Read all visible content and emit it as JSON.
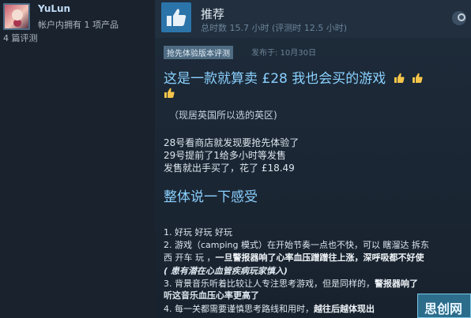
{
  "user": {
    "name": "YuLun",
    "owned": "帐户内拥有 1 项产品",
    "reviews": "4 篇评测"
  },
  "review": {
    "verdict": "推荐",
    "hours": "总时数 15.7 小时 (评测时 12.5 小时)",
    "early_access_tag": "抢先体验版本评测",
    "posted": "发布于: 10月30日",
    "headline": "这是一款就算卖 £28 我也会买的游戏",
    "region": "（现居英国所以选的英区)",
    "notes": [
      "28号看商店就发现要抢先体验了",
      "29号提前了1给多小时等发售",
      "发售就出手买了，花了 £18.49"
    ],
    "section_title": "整体说一下感受",
    "items": {
      "i1": "1. 好玩 好玩 好玩",
      "i2a": "2. 游戏（camping 模式）在开始节奏一点也不快，可以 瞎溜达 拆东",
      "i2b_prefix": "西 开车 玩 ，",
      "i2b_bold": "一旦警报器响了心率血压蹭蹭往上涨，深呼吸都不好使",
      "i2c": "( 患有潜在心血管疾病玩家慎入)",
      "i3a_prefix": "3. 背景音乐听着比较让人专注思考游戏，但是同样的，",
      "i3a_bold": "警报器响了",
      "i3b": "听这音乐血压心率更高了",
      "i4_prefix": "4. 每一关都需要谨慎思考路线和用时，",
      "i4_bold": "越往后越体现出"
    }
  },
  "watermark": "思创网",
  "colors": {
    "background": "#1b2838",
    "header": "#212f3f",
    "thumb": "#2b74aa",
    "heading_blue": "#8ad1ff",
    "emoji_yellow": "#f5c54a"
  },
  "icons": [
    "thumbs-up-icon",
    "steam-icon",
    "thumbs-emoji-icon"
  ]
}
